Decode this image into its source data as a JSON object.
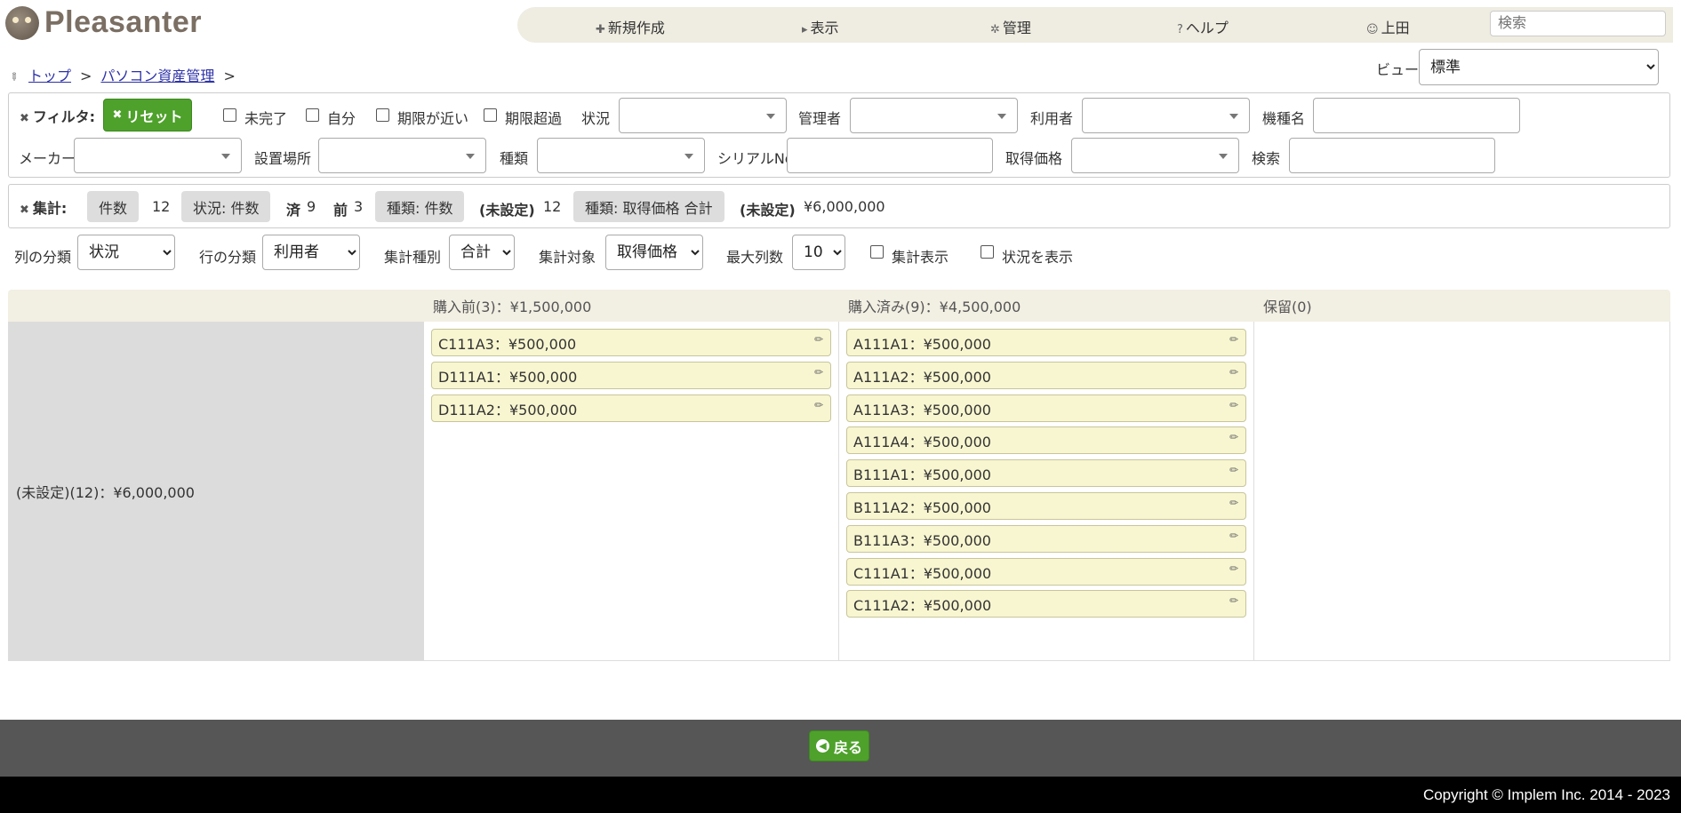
{
  "app": {
    "name": "Pleasanter"
  },
  "nav": {
    "new": "新規作成",
    "view": "表示",
    "admin": "管理",
    "help": "ヘルプ",
    "user": "上田",
    "search_placeholder": "検索"
  },
  "breadcrumb": {
    "top": "トップ",
    "site": "パソコン資産管理",
    "sep": ">"
  },
  "viewSelector": {
    "label": "ビュー",
    "value": "標準"
  },
  "filters": {
    "title": "フィルタ:",
    "reset": "リセット",
    "incomplete": "未完了",
    "self": "自分",
    "near_deadline": "期限が近い",
    "overdue": "期限超過",
    "status": "状況",
    "manager": "管理者",
    "user": "利用者",
    "model": "機種名",
    "maker": "メーカー",
    "location": "設置場所",
    "category": "種類",
    "serial": "シリアルNo",
    "price": "取得価格",
    "search": "検索"
  },
  "aggregations": {
    "title": "集計:",
    "count_label": "件数",
    "count_value": "12",
    "status_label": "状況: 件数",
    "done_label": "済",
    "done_value": "9",
    "before_label": "前",
    "before_value": "3",
    "category_count_label": "種類: 件数",
    "unset_label_1": "(未設定)",
    "unset_value_1": "12",
    "category_sum_label": "種類: 取得価格 合計",
    "unset_label_2": "(未設定)",
    "unset_value_2": "¥6,000,000"
  },
  "settings": {
    "col_group_label": "列の分類",
    "col_group_value": "状況",
    "row_group_label": "行の分類",
    "row_group_value": "利用者",
    "agg_type_label": "集計種別",
    "agg_type_value": "合計",
    "agg_target_label": "集計対象",
    "agg_target_value": "取得価格",
    "max_cols_label": "最大列数",
    "max_cols_value": "10",
    "show_agg": "集計表示",
    "show_status": "状況を表示"
  },
  "board": {
    "row_header": "(未設定)(12)：¥6,000,000",
    "columns": [
      {
        "header": "購入前(3)：¥1,500,000",
        "cards": [
          "C111A3：¥500,000",
          "D111A1：¥500,000",
          "D111A2：¥500,000"
        ]
      },
      {
        "header": "購入済み(9)：¥4,500,000",
        "cards": [
          "A111A1：¥500,000",
          "A111A2：¥500,000",
          "A111A3：¥500,000",
          "A111A4：¥500,000",
          "B111A1：¥500,000",
          "B111A2：¥500,000",
          "B111A3：¥500,000",
          "C111A1：¥500,000",
          "C111A2：¥500,000"
        ]
      },
      {
        "header": "保留(0)",
        "cards": []
      }
    ]
  },
  "footer": {
    "back": "戻る",
    "copyright": "Copyright © Implem Inc. 2014 - 2023"
  },
  "colors": {
    "accent_green": "#4ea12b",
    "card_bg": "#f8f6d0",
    "header_bg": "#f2efe3",
    "footer_bg": "#565656"
  }
}
